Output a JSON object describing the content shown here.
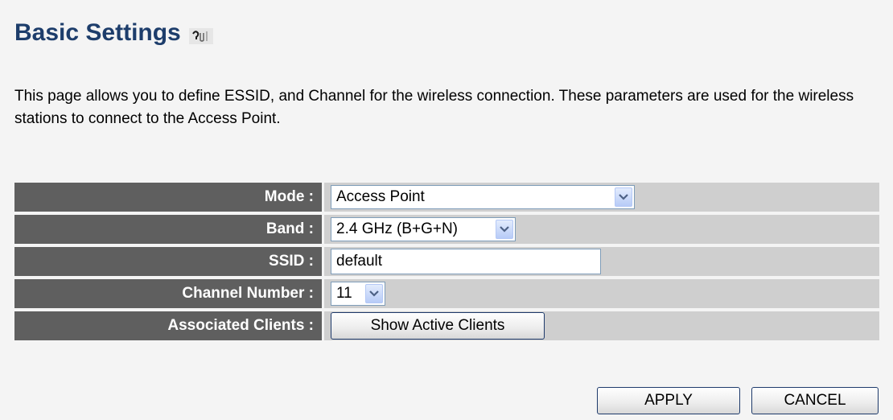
{
  "page": {
    "title": "Basic Settings",
    "description": "This page allows you to define ESSID, and Channel for the wireless connection. These parameters are used for the wireless stations to connect to the Access Point."
  },
  "form": {
    "mode": {
      "label": "Mode :",
      "value": "Access Point"
    },
    "band": {
      "label": "Band :",
      "value": "2.4 GHz (B+G+N)"
    },
    "ssid": {
      "label": "SSID :",
      "value": "default"
    },
    "channel": {
      "label": "Channel Number :",
      "value": "11"
    },
    "clients": {
      "label": "Associated Clients :",
      "button_label": "Show Active Clients"
    }
  },
  "actions": {
    "apply_label": "APPLY",
    "cancel_label": "CANCEL"
  },
  "icons": {
    "help": "help-icon",
    "dropdown": "chevron-down-icon"
  },
  "colors": {
    "title": "#1d3d6b",
    "label_bg": "#5f5f5f",
    "value_bg": "#cfcfcf",
    "page_bg": "#f4f4f4"
  }
}
